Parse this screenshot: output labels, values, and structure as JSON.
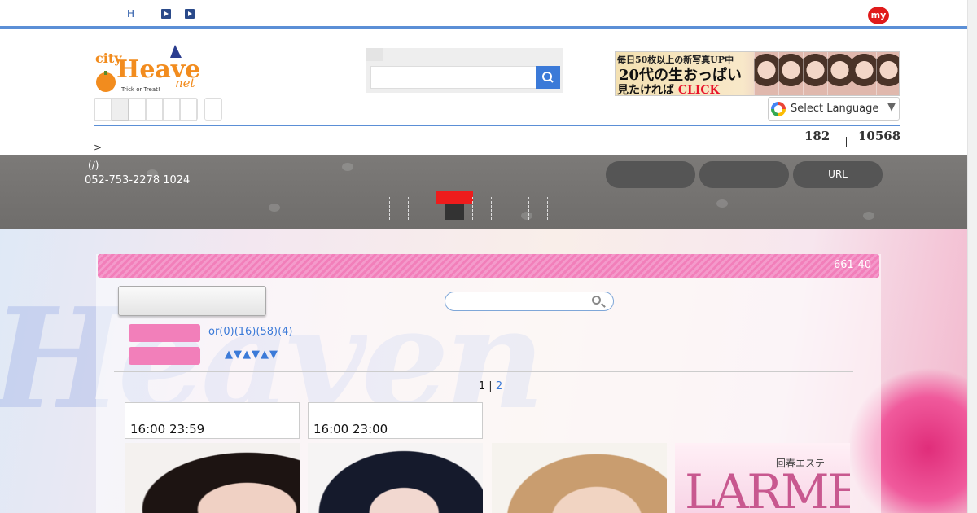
{
  "topbar": {
    "h_label": "H",
    "my_badge": "my"
  },
  "header": {
    "logo": {
      "main": "Heaven",
      "prefix": "city",
      "suffix": "net",
      "tagline": "Trick or Treat!"
    },
    "search": {
      "value": "",
      "placeholder": ""
    },
    "banner": {
      "line1": "毎日50枚以上の新写真UP中",
      "line2": "20代の生おっぱい",
      "line3_prefix": "見たければ",
      "line3_click": "CLICK"
    },
    "language": {
      "label": "Select Language",
      "arrow": "▼"
    },
    "counts": {
      "first": "182",
      "second": "10568"
    },
    "breadcrumb": ">"
  },
  "shop": {
    "paren": "(/)",
    "phone_line": "052-753-2278 1024",
    "pills": [
      "",
      "",
      "URL"
    ]
  },
  "list": {
    "count": "661-40",
    "filters_text": "or(0)(16)(58)(4)",
    "sort_arrows": "▲▼▲▼▲▼",
    "pager": {
      "current": "1",
      "separator": "|",
      "next": "2"
    },
    "cards": [
      {
        "time": "16:00 23:59"
      },
      {
        "time": "16:00 23:00"
      }
    ],
    "shop_banner": {
      "small": "回春エステ",
      "big": "LARME"
    }
  },
  "colors": {
    "accent_blue": "#5b8fd6",
    "pink": "#f27fba",
    "badge_red": "#e01b1b",
    "link_blue": "#3b7ad8"
  }
}
